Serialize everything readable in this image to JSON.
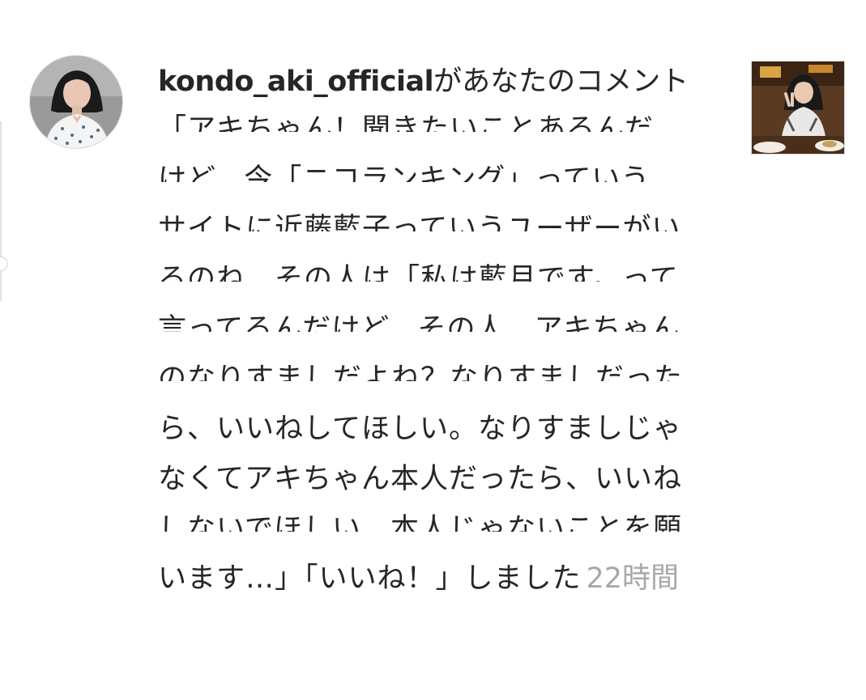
{
  "notification": {
    "username": "kondo_aki_official",
    "action_text": "があなたのコメント",
    "comment_lines": [
      "「アキちゃん！聞きたいことあるんだ",
      "けど、今「ニコランキング」っていう",
      "サイトに近藤藍子っていうユーザーがい",
      "るのね、その人は「私は藍月です。って",
      "言ってるんだけど、その人、アキちゃん",
      "のなりすましだよね？なりすましだった",
      "ら、いいねしてほしい。なりすましじゃ",
      "なくてアキちゃん本人だったら、いいね",
      "しないでほしい…本人じゃないことを願"
    ],
    "last_line": "います…」「いいね！」しました",
    "time": "22時間"
  },
  "colors": {
    "text": "#262626",
    "timestamp": "#a8a8a8",
    "border": "#dbdbdb"
  }
}
